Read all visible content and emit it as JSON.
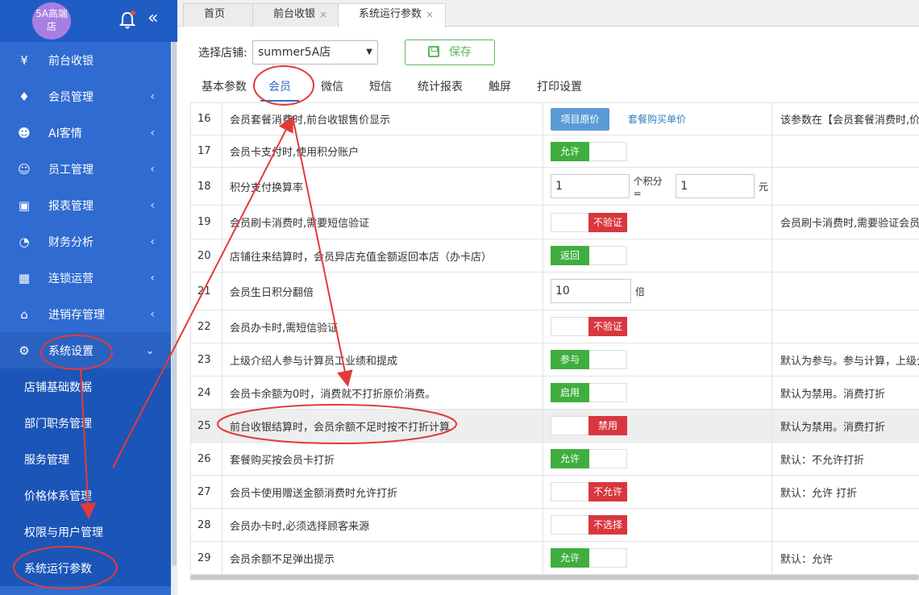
{
  "sidebar": {
    "logo_text": "5A高端店",
    "collapse_icon": "«",
    "menu": [
      {
        "label": "前台收银",
        "icon": "¥"
      },
      {
        "label": "会员管理",
        "icon": "♦"
      },
      {
        "label": "AI客情",
        "icon": "☻"
      },
      {
        "label": "员工管理",
        "icon": "☺"
      },
      {
        "label": "报表管理",
        "icon": "▣"
      },
      {
        "label": "财务分析",
        "icon": "◔"
      },
      {
        "label": "连锁运营",
        "icon": "▦"
      },
      {
        "label": "进销存管理",
        "icon": "⌂"
      },
      {
        "label": "系统设置",
        "icon": "⚙"
      }
    ],
    "submenu": [
      "店铺基础数据",
      "部门职务管理",
      "服务管理",
      "价格体系管理",
      "权限与用户管理",
      "系统运行参数"
    ]
  },
  "tabs": [
    {
      "label": "首页"
    },
    {
      "label": "前台收银",
      "close": "×"
    },
    {
      "label": "系统运行参数",
      "close": "×"
    }
  ],
  "toolbar": {
    "store_label": "选择店铺:",
    "store_value": "summer5A店",
    "save_label": "保存"
  },
  "subtabs": [
    "基本参数",
    "会员",
    "微信",
    "短信",
    "统计报表",
    "触屏",
    "打印设置"
  ],
  "rows": [
    {
      "num": "16",
      "desc": "会员套餐消费时,前台收银售价显示",
      "btn": "项目原价",
      "link": "套餐购买单价",
      "note": "该参数在【会员套餐消费时,价格"
    },
    {
      "num": "17",
      "desc": "会员卡支付时,使用积分账户",
      "switch": "允许",
      "state": "on",
      "note": ""
    },
    {
      "num": "18",
      "desc": "积分支付换算率",
      "in1": "1",
      "mid": "个积分 =",
      "in2": "1",
      "unit": "元",
      "note": ""
    },
    {
      "num": "19",
      "desc": "会员刷卡消费时,需要短信验证",
      "switch": "不验证",
      "state": "off",
      "note": "会员刷卡消费时,需要验证会员卡"
    },
    {
      "num": "20",
      "desc": "店铺往来结算时，会员异店充值金额返回本店（办卡店）",
      "switch": "返回",
      "state": "on",
      "note": ""
    },
    {
      "num": "21",
      "desc": "会员生日积分翻倍",
      "in1": "10",
      "unit": "倍",
      "note": ""
    },
    {
      "num": "22",
      "desc": "会员办卡时,需短信验证",
      "switch": "不验证",
      "state": "off",
      "note": ""
    },
    {
      "num": "23",
      "desc": "上级介绍人参与计算员工业绩和提成",
      "switch": "参与",
      "state": "on",
      "note": "默认为参与。参与计算，上级介绍"
    },
    {
      "num": "24",
      "desc": "会员卡余额为0时，消费就不打折原价消费。",
      "switch": "启用",
      "state": "on",
      "note": "默认为禁用。消费打折"
    },
    {
      "num": "25",
      "desc": "前台收银结算时，会员余额不足时按不打折计算",
      "switch": "禁用",
      "state": "off",
      "note": "默认为禁用。消费打折"
    },
    {
      "num": "26",
      "desc": "套餐购买按会员卡打折",
      "switch": "允许",
      "state": "on",
      "note": "默认：不允许打折"
    },
    {
      "num": "27",
      "desc": "会员卡使用赠送金额消费时允许打折",
      "switch": "不允许",
      "state": "off",
      "note": "默认：允许 打折"
    },
    {
      "num": "28",
      "desc": "会员办卡时,必须选择顾客来源",
      "switch": "不选择",
      "state": "off",
      "note": ""
    },
    {
      "num": "29",
      "desc": "会员余额不足弹出提示",
      "switch": "允许",
      "state": "on",
      "note": "默认：允许"
    }
  ]
}
